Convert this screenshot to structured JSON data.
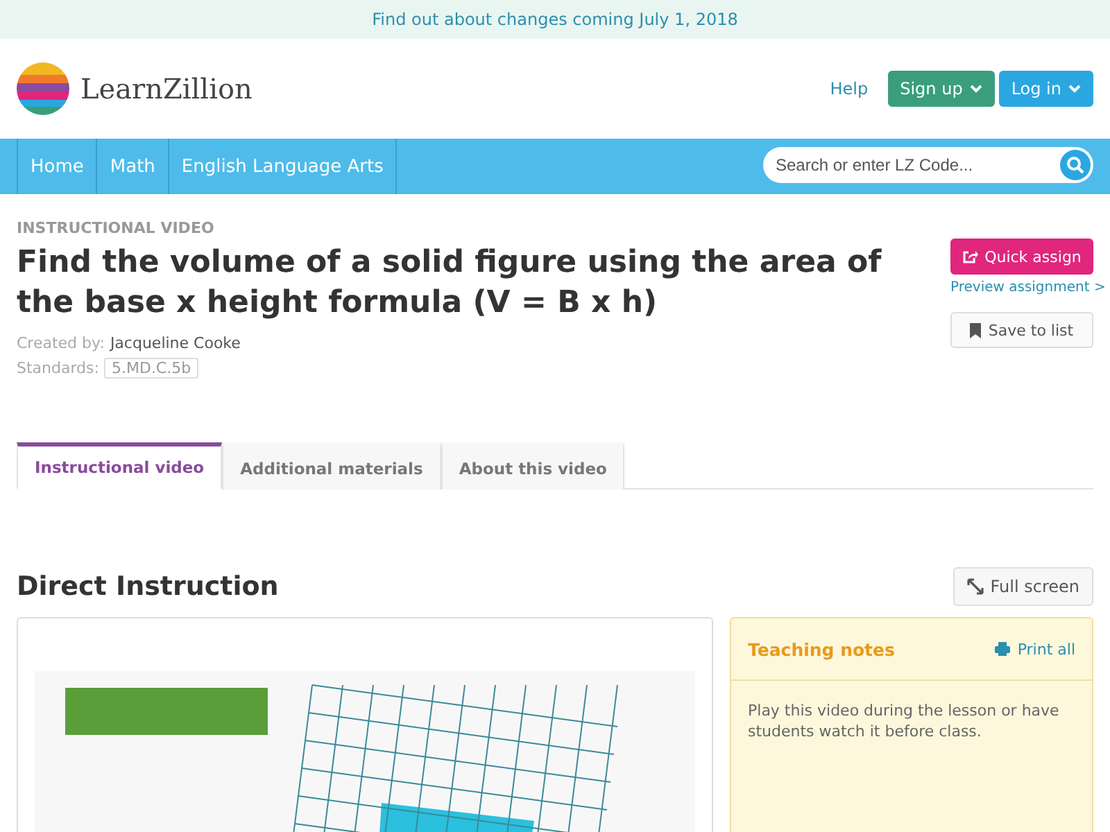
{
  "banner": {
    "text": "Find out about changes coming July 1, 2018"
  },
  "header": {
    "logo_text": "LearnZillion",
    "help": "Help",
    "sign_up": "Sign up",
    "log_in": "Log in"
  },
  "nav": {
    "items": [
      {
        "label": "Home"
      },
      {
        "label": "Math"
      },
      {
        "label": "English Language Arts"
      }
    ],
    "search": {
      "placeholder": "Search or enter LZ Code..."
    }
  },
  "lesson": {
    "eyebrow": "INSTRUCTIONAL VIDEO",
    "title": "Find the volume of a solid figure using the area of the base x height formula (V = B x h)",
    "created_by_label": "Created by:",
    "author": "Jacqueline Cooke",
    "standards_label": "Standards:",
    "standard": "5.MD.C.5b",
    "quick_assign": "Quick assign",
    "preview": "Preview assignment >",
    "save": "Save to list"
  },
  "tabs": [
    {
      "label": "Instructional video",
      "selected": true
    },
    {
      "label": "Additional materials",
      "selected": false
    },
    {
      "label": "About this video",
      "selected": false
    }
  ],
  "section": {
    "title": "Direct Instruction",
    "full_screen": "Full screen"
  },
  "notes": {
    "title": "Teaching notes",
    "print": "Print all",
    "text": "Play this video during the lesson or have students watch it before class."
  }
}
